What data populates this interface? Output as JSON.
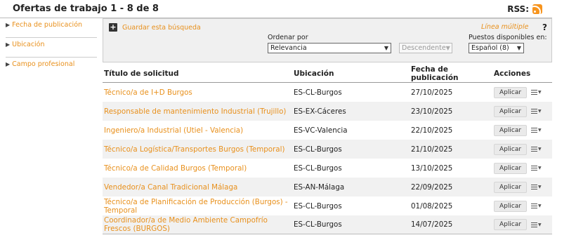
{
  "header": {
    "title": "Ofertas de trabajo 1 - 8 de 8",
    "rss_label": "RSS:"
  },
  "sidebar": {
    "facets": [
      {
        "label": "Fecha de publicación"
      },
      {
        "label": "Ubicación"
      },
      {
        "label": "Campo profesional"
      }
    ]
  },
  "filters": {
    "save_search": "Guardar esta búsqueda",
    "linea_multiple": "Línea múltiple",
    "help": "?",
    "order_label": "Ordenar por",
    "order_value": "Relevancia",
    "direction_value": "Descendente",
    "positions_label": "Puestos disponibles en:",
    "language_value": "Español (8)"
  },
  "table": {
    "headers": [
      "Título de solicitud",
      "Ubicación",
      "Fecha de publicación",
      "Acciones"
    ],
    "action_label": "Aplicar",
    "rows": [
      {
        "title": "Técnico/a de I+D Burgos",
        "location": "ES-CL-Burgos",
        "date": "27/10/2025"
      },
      {
        "title": "Responsable de mantenimiento Industrial (Trujillo)",
        "location": "ES-EX-Cáceres",
        "date": "23/10/2025"
      },
      {
        "title": "Ingeniero/a Industrial (Utiel - Valencia)",
        "location": "ES-VC-Valencia",
        "date": "22/10/2025"
      },
      {
        "title": "Técnico/a Logística/Transportes Burgos (Temporal)",
        "location": "ES-CL-Burgos",
        "date": "21/10/2025"
      },
      {
        "title": "Técnico/a de Calidad Burgos (Temporal)",
        "location": "ES-CL-Burgos",
        "date": "13/10/2025"
      },
      {
        "title": "Vendedor/a Canal Tradicional Málaga",
        "location": "ES-AN-Málaga",
        "date": "22/09/2025"
      },
      {
        "title": "Técnico/a de Planificación de Producción (Burgos) - Temporal",
        "location": "ES-CL-Burgos",
        "date": "01/08/2025"
      },
      {
        "title": "Coordinador/a de Medio Ambiente Campofrío Frescos (BURGOS)",
        "location": "ES-CL-Burgos",
        "date": "14/07/2025"
      }
    ]
  },
  "colors": {
    "accent": "#e8901c",
    "rss": "#f7941d",
    "row_alt": "#f1f1f1"
  }
}
